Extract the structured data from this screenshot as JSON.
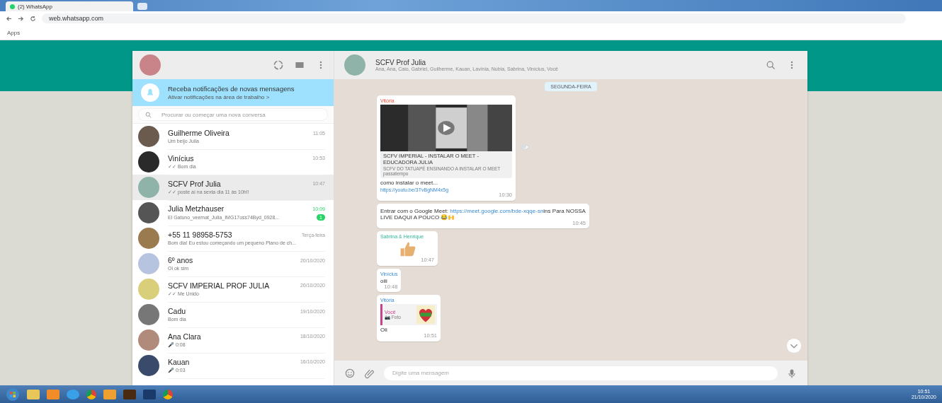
{
  "browser": {
    "tab_title": "(2) WhatsApp",
    "url": "web.whatsapp.com",
    "bookmarks": [
      "Apps"
    ]
  },
  "sidebar": {
    "notification": {
      "title": "Receba notificações de novas mensagens",
      "subtitle": "Ativar notificações na área de trabalho >"
    },
    "search": {
      "placeholder": "Procurar ou começar uma nova conversa"
    },
    "chats": [
      {
        "name": "Guilherme Oliveira",
        "preview": "Um beijo Julia",
        "time": "11:05",
        "selected": false
      },
      {
        "name": "Vinícius",
        "preview": "✓✓ Bom dia",
        "time": "10:53",
        "selected": false
      },
      {
        "name": "SCFV Prof Julia",
        "preview": "✓✓ poste aí na sexta dia 11 às 10h!!",
        "time": "10:47",
        "selected": true
      },
      {
        "name": "Julia Metzhauser",
        "preview": "El Gatuno_veemat_Julia_IMG17oss74Byd_0928...",
        "time": "10:09",
        "selected": false,
        "unread": "1"
      },
      {
        "name": "+55 11 98958-5753",
        "preview": "Bom dia! Eu estou começando um pequeno Plano de ch...",
        "time": "Terça-feira",
        "selected": false
      },
      {
        "name": "6º anos",
        "preview": "Oi ok sim",
        "time": "20/10/2020",
        "selected": false
      },
      {
        "name": "SCFV IMPERIAL PROF JULIA",
        "preview": "✓✓ Me Unido",
        "time": "20/10/2020",
        "selected": false
      },
      {
        "name": "Cadu",
        "preview": "Bom dia",
        "time": "19/10/2020",
        "selected": false
      },
      {
        "name": "Ana Clara",
        "preview": "🎤 0:08",
        "time": "18/10/2020",
        "selected": false
      },
      {
        "name": "Kauan",
        "preview": "🎤 0:03",
        "time": "16/10/2020",
        "selected": false
      }
    ]
  },
  "chat": {
    "title": "SCFV Prof Julia",
    "members": "Ana, Ana, Caio, Gabriel, Guilherme, Kauan, Lavínia, Nubia, Sabrina, Vinícius, Você",
    "date_chip": "SEGUNDA-FEIRA",
    "messages": [
      {
        "kind": "link_preview",
        "sender": "Vitória",
        "title": "SCFV IMPERIAL - INSTALAR O MEET - EDUCADORA JULIA",
        "description": "SCFV DO TATUAPÉ ENSINANDO A INSTALAR O MEET passatempo",
        "text": "como instalar o meet...",
        "link": "https://youtu.be/3TvBgNM4x5g",
        "time": "10:30"
      },
      {
        "kind": "text",
        "text": "Entrar com o Google Meet: ",
        "link": "https://meet.google.com/bde-xqqe-sn",
        "text2": "ins Para NOSSA LIVE DAQUI A POUCO 😂🙌",
        "time": "10:45"
      },
      {
        "kind": "sticker",
        "sender": "Sabrina & Henrique",
        "time": "10:47"
      },
      {
        "kind": "text",
        "sender": "Vinícius",
        "text": "oiii",
        "time": "10:48"
      },
      {
        "kind": "quote",
        "sender": "Vitória",
        "quote_author": "Você",
        "quote_text": "📷 Foto",
        "text": "Oii",
        "time": "10:51"
      }
    ],
    "input": {
      "placeholder": "Digite uma mensagem"
    }
  },
  "taskbar": {
    "time": "10:51",
    "date": "21/10/2020"
  }
}
